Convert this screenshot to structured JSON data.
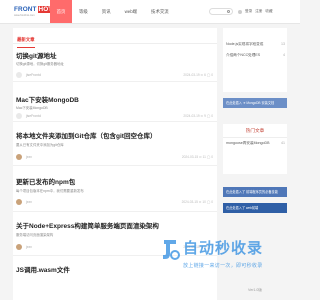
{
  "header": {
    "logo": {
      "word": "FRONT",
      "badge": "HOT",
      "sub": "www.fronthot.com"
    },
    "nav": [
      "首页",
      "等级",
      "资讯",
      "web端",
      "技术交流"
    ],
    "user_links": [
      "登录",
      "注册",
      "收藏"
    ]
  },
  "main": {
    "section_title": "最新文章",
    "articles": [
      {
        "title": "切换git源地址",
        "summary": "切换git源地，切换git服务器地址",
        "author": "jiseFrontd",
        "meta": "2024-03-19  ⊙ 6  ◯ 0",
        "avatar": "pale"
      },
      {
        "title": "Mac下安装MongoDB",
        "summary": "Mac下安装MongoDB",
        "author": "jiseFrontd",
        "meta": "2024-03-19  ⊙ 9  ◯ 0",
        "avatar": "pale"
      },
      {
        "title": "将本地文件夹添加到Git仓库（包含git回空仓库）",
        "summary": "要从已有文件夹中添加为git仓库",
        "author": "jxxx",
        "meta": "2024-03-15  ⊙ 11  ◯ 0",
        "avatar": "photo"
      },
      {
        "title": "更新已发布的npm包",
        "summary": "每个项目包版本在npm中，我们需要重新发布",
        "author": "jxxx",
        "meta": "2024-03-15  ⊙ 10  ◯ 0",
        "avatar": "photo"
      },
      {
        "title": "关于Node+Express构建简单服务端页面渲染架构",
        "summary": "服务端访问页面渲染架构",
        "author": "jxxx",
        "meta": "2024-03-15  ⊙ 9  ◯ 0",
        "avatar": "photo"
      },
      {
        "title": "JS调用.wasm文件",
        "summary": "",
        "author": "",
        "meta": "",
        "avatar": "none"
      }
    ]
  },
  "sidebar": {
    "latest": [
      {
        "label": "Node.js实现将字段变成",
        "n": "13"
      },
      {
        "label": "介绍两个NCC处理ES",
        "n": "4"
      }
    ],
    "banner1": "在此处插入 ➜ MongoDB 安装文档",
    "hot_title": "热门文章",
    "hot": [
      {
        "label": "mongoose再安装MongoDB",
        "n": "41"
      }
    ],
    "banner2": "在此处插入了 前端程序员的必备技能",
    "banner3": "在此处插入了 web前端",
    "version": "Ver1.0版"
  },
  "watermark": {
    "title": "自动秒收录",
    "sub": "放上链接一来访一次，即可秒收录"
  },
  "colors": {
    "accent": "#e53935",
    "nav_active": "#ff6b6b",
    "brand_blue": "#2a62b8"
  }
}
